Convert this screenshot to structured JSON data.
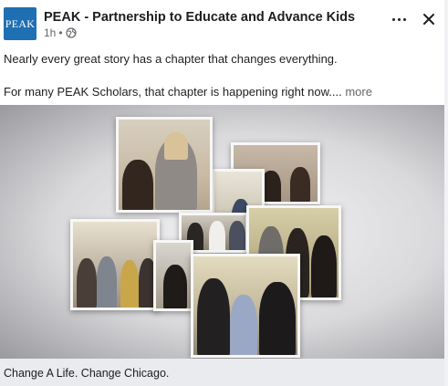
{
  "post": {
    "page_name": "PEAK - Partnership to Educate and Advance Kids",
    "time": "1h",
    "separator": "•",
    "audience_icon": "globe-icon",
    "logo_text": "PEAK",
    "text_line1": "Nearly every great story has a chapter that changes everything.",
    "text_line2": "For many PEAK Scholars, that chapter is happening right now....",
    "see_more": "more",
    "more_icon": "more-horizontal-icon",
    "close_icon": "close-icon"
  },
  "media": {
    "link_title": "Change A Life. Change Chicago."
  },
  "colors": {
    "logo_bg": "#1f6fb3",
    "footer_bg": "#e9ebee",
    "meta_text": "#65676b"
  }
}
